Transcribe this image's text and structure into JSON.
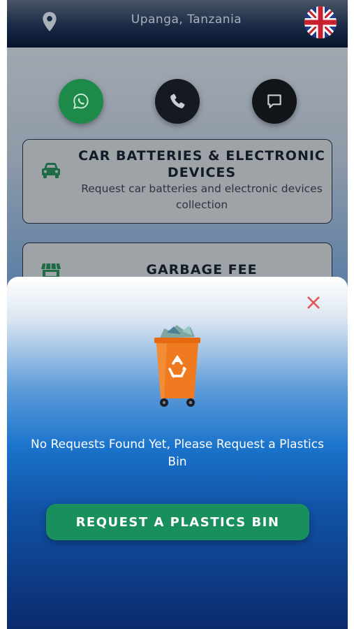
{
  "header": {
    "location": "Upanga, Tanzania",
    "location_icon": "location-pin-icon",
    "language_icon": "uk-flag-icon"
  },
  "contact": {
    "whatsapp_icon": "whatsapp-icon",
    "call_icon": "phone-icon",
    "message_icon": "chat-icon"
  },
  "services": [
    {
      "title": "CAR BATTERIES & ELECTRONIC DEVICES",
      "description": "Request car batteries and electronic devices collection",
      "icon": "car-icon"
    },
    {
      "title": "GARBAGE FEE",
      "icon": "store-icon"
    }
  ],
  "modal": {
    "close_icon": "close-icon",
    "illustration": "recycle-bin-icon",
    "message": "No Requests Found Yet, Please Request a Plastics Bin",
    "action_label": "REQUEST A PLASTICS BIN"
  },
  "colors": {
    "primary_green": "#1a8f5e",
    "close_red": "#e05a5a",
    "bin_orange": "#f07a1f"
  }
}
